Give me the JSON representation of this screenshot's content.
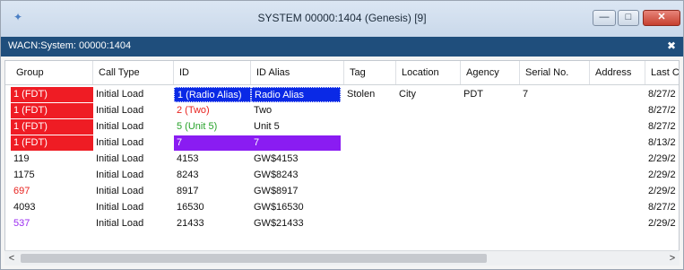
{
  "window": {
    "title": "SYSTEM 00000:1404 (Genesis) [9]",
    "app_icon": "app-icon",
    "controls": {
      "minimize": "—",
      "maximize": "□",
      "close": "✕"
    }
  },
  "subheader": {
    "label": "WACN:System: 00000:1404",
    "tools_icon": "wrench-screwdriver-icon"
  },
  "columns": [
    "Group",
    "Call Type",
    "ID",
    "ID Alias",
    "Tag",
    "Location",
    "Agency",
    "Serial No.",
    "Address",
    "Last Co"
  ],
  "rows": [
    {
      "group": "1 (FDT)",
      "call_type": "Initial Load",
      "id": "1 (Radio Alias)",
      "id_alias": "Radio Alias",
      "tag": "Stolen",
      "location": "City",
      "agency": "PDT",
      "serial": "7",
      "address": "",
      "last": "8/27/2"
    },
    {
      "group": "1 (FDT)",
      "call_type": "Initial Load",
      "id": "2 (Two)",
      "id_alias": "Two",
      "tag": "",
      "location": "",
      "agency": "",
      "serial": "",
      "address": "",
      "last": "8/27/2"
    },
    {
      "group": "1 (FDT)",
      "call_type": "Initial Load",
      "id": "5 (Unit 5)",
      "id_alias": "Unit 5",
      "tag": "",
      "location": "",
      "agency": "",
      "serial": "",
      "address": "",
      "last": "8/27/2"
    },
    {
      "group": "1 (FDT)",
      "call_type": "Initial Load",
      "id": "7",
      "id_alias": "7",
      "tag": "",
      "location": "",
      "agency": "",
      "serial": "",
      "address": "",
      "last": "8/13/2"
    },
    {
      "group": "119",
      "call_type": "Initial Load",
      "id": "4153",
      "id_alias": "GW$4153",
      "tag": "",
      "location": "",
      "agency": "",
      "serial": "",
      "address": "",
      "last": "2/29/2"
    },
    {
      "group": "1175",
      "call_type": "Initial Load",
      "id": "8243",
      "id_alias": "GW$8243",
      "tag": "",
      "location": "",
      "agency": "",
      "serial": "",
      "address": "",
      "last": "2/29/2"
    },
    {
      "group": "697",
      "call_type": "Initial Load",
      "id": "8917",
      "id_alias": "GW$8917",
      "tag": "",
      "location": "",
      "agency": "",
      "serial": "",
      "address": "",
      "last": "2/29/2"
    },
    {
      "group": "4093",
      "call_type": "Initial Load",
      "id": "16530",
      "id_alias": "GW$16530",
      "tag": "",
      "location": "",
      "agency": "",
      "serial": "",
      "address": "",
      "last": "8/27/2"
    },
    {
      "group": "537",
      "call_type": "Initial Load",
      "id": "21433",
      "id_alias": "GW$21433",
      "tag": "",
      "location": "",
      "agency": "",
      "serial": "",
      "address": "",
      "last": "2/29/2"
    }
  ],
  "scrollbar": {
    "left_arrow": "<",
    "right_arrow": ">"
  },
  "colors": {
    "fdt_red": "#ef1c24",
    "selected_blue": "#0a29e6",
    "purple": "#8a1cf2",
    "header_navy": "#1f4e7c"
  }
}
